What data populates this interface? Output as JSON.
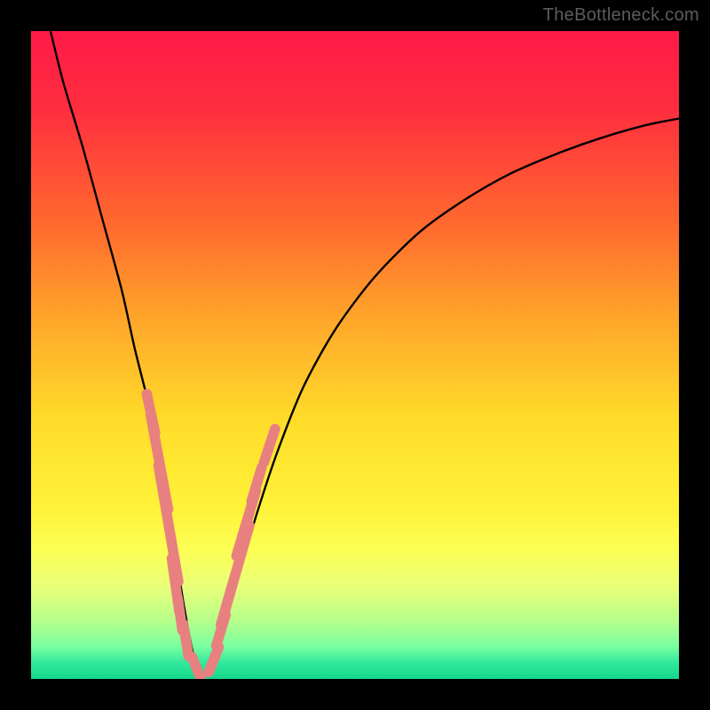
{
  "watermark": "TheBottleneck.com",
  "chart_data": {
    "type": "line",
    "title": "",
    "xlabel": "",
    "ylabel": "",
    "xlim": [
      0,
      100
    ],
    "ylim": [
      0,
      100
    ],
    "gradient_stops": [
      {
        "offset": 0.0,
        "color": "#ff1a47"
      },
      {
        "offset": 0.12,
        "color": "#ff2e3f"
      },
      {
        "offset": 0.3,
        "color": "#ff6a2e"
      },
      {
        "offset": 0.45,
        "color": "#ffa82a"
      },
      {
        "offset": 0.6,
        "color": "#ffdc2a"
      },
      {
        "offset": 0.74,
        "color": "#fff33a"
      },
      {
        "offset": 0.8,
        "color": "#fcff55"
      },
      {
        "offset": 0.86,
        "color": "#e8ff7a"
      },
      {
        "offset": 0.91,
        "color": "#b6ff8a"
      },
      {
        "offset": 0.95,
        "color": "#7affa0"
      },
      {
        "offset": 0.975,
        "color": "#32e89c"
      },
      {
        "offset": 1.0,
        "color": "#14d88a"
      }
    ],
    "series": [
      {
        "name": "bottleneck-curve",
        "x": [
          3,
          5,
          8,
          11,
          14,
          16,
          18,
          19.5,
          20.8,
          22.0,
          23.0,
          24.0,
          25.0,
          26.2,
          27.3,
          28.5,
          30.0,
          32.0,
          35.0,
          38.0,
          42.0,
          47.0,
          53.0,
          60.0,
          67.0,
          74.0,
          81.0,
          88.0,
          95.0,
          100.0
        ],
        "y": [
          100,
          92,
          82,
          71,
          60,
          51,
          43,
          36,
          29,
          22,
          15,
          9,
          4,
          1,
          1,
          4,
          9,
          16,
          26,
          35,
          45,
          54,
          62,
          69,
          74,
          78,
          81,
          83.5,
          85.5,
          86.5
        ]
      }
    ],
    "markers": {
      "name": "data-points",
      "color": "#e98080",
      "points": [
        {
          "x": 18.5,
          "y": 41.0,
          "len": 3.5
        },
        {
          "x": 19.8,
          "y": 33.5,
          "len": 7.5
        },
        {
          "x": 21.2,
          "y": 24.0,
          "len": 9.0
        },
        {
          "x": 22.3,
          "y": 14.5,
          "len": 4.5
        },
        {
          "x": 23.0,
          "y": 10.0,
          "len": 3.0
        },
        {
          "x": 23.9,
          "y": 6.0,
          "len": 3.0
        },
        {
          "x": 25.6,
          "y": 1.5,
          "len": 2.6
        },
        {
          "x": 28.2,
          "y": 3.0,
          "len": 2.6
        },
        {
          "x": 29.3,
          "y": 7.5,
          "len": 3.0
        },
        {
          "x": 30.2,
          "y": 11.5,
          "len": 3.5
        },
        {
          "x": 31.5,
          "y": 16.0,
          "len": 8.0
        },
        {
          "x": 33.2,
          "y": 24.0,
          "len": 5.5
        },
        {
          "x": 34.8,
          "y": 30.0,
          "len": 3.2
        },
        {
          "x": 36.8,
          "y": 36.0,
          "len": 3.2
        }
      ]
    }
  }
}
